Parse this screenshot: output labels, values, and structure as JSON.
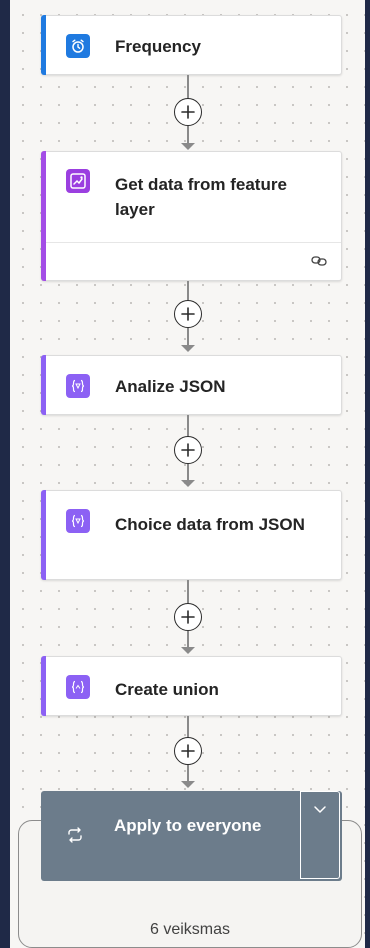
{
  "flow": {
    "steps": [
      {
        "title": "Frequency",
        "icon": "alarm-clock-icon",
        "accent": "#1f7ae0",
        "icon_bg": "#1f7ae0"
      },
      {
        "title": "Get data from feature layer",
        "icon": "arcgis-icon",
        "accent": "#a34de6",
        "icon_bg": "#9b3fe0"
      },
      {
        "title": "Analize JSON",
        "icon": "curly-braces-icon",
        "accent": "#8c61f4",
        "icon_bg": "#8c61f4"
      },
      {
        "title": "Choice data from JSON",
        "icon": "curly-braces-icon",
        "accent": "#8c61f4",
        "icon_bg": "#8c61f4"
      },
      {
        "title": "Create union",
        "icon": "curly-braces-icon",
        "accent": "#8c61f4",
        "icon_bg": "#8c61f4"
      }
    ],
    "scope": {
      "title": "Apply to everyone",
      "icon": "loop-icon",
      "count_label": "6 veiksmas",
      "header_color": "#6c7c8b"
    },
    "colors": {
      "background": "#1f2947",
      "canvas": "#f7f6f4",
      "connector": "#8a8a8a"
    }
  }
}
